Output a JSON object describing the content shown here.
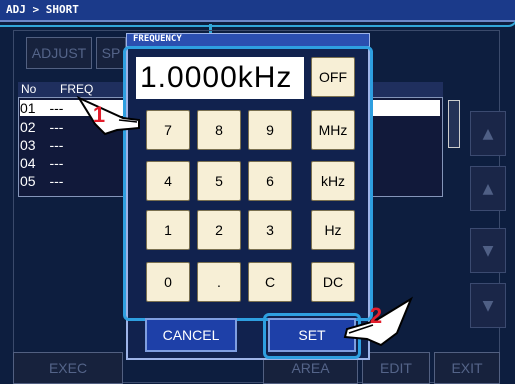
{
  "topbar": {
    "breadcrumb": "ADJ > SHORT"
  },
  "background": {
    "adjust_button": "ADJUST",
    "sp_button": "SP",
    "list_header": {
      "no": "No",
      "freq": "FREQ"
    },
    "rows": [
      {
        "no": "01",
        "freq": "---",
        "selected": true
      },
      {
        "no": "02",
        "freq": "---"
      },
      {
        "no": "03",
        "freq": "---"
      },
      {
        "no": "04",
        "freq": "---"
      },
      {
        "no": "05",
        "freq": "---"
      }
    ],
    "bottom": {
      "exec": "EXEC",
      "area": "AREA",
      "edit": "EDIT",
      "exit": "EXIT"
    }
  },
  "dialog": {
    "title": "FREQUENCY",
    "display": "1.0000kHz",
    "keys": {
      "off": "OFF",
      "k7": "7",
      "k8": "8",
      "k9": "9",
      "mhz": "MHz",
      "k4": "4",
      "k5": "5",
      "k6": "6",
      "khz": "kHz",
      "k1": "1",
      "k2": "2",
      "k3": "3",
      "hz": "Hz",
      "k0": "0",
      "dot": ".",
      "c": "C",
      "dc": "DC"
    },
    "cancel": "CANCEL",
    "set": "SET"
  },
  "annotations": {
    "step1": "1",
    "step2": "2"
  },
  "colors": {
    "callout": "#32a6d9",
    "step": "#e31d2b",
    "key_bg": "#f7efd6"
  }
}
